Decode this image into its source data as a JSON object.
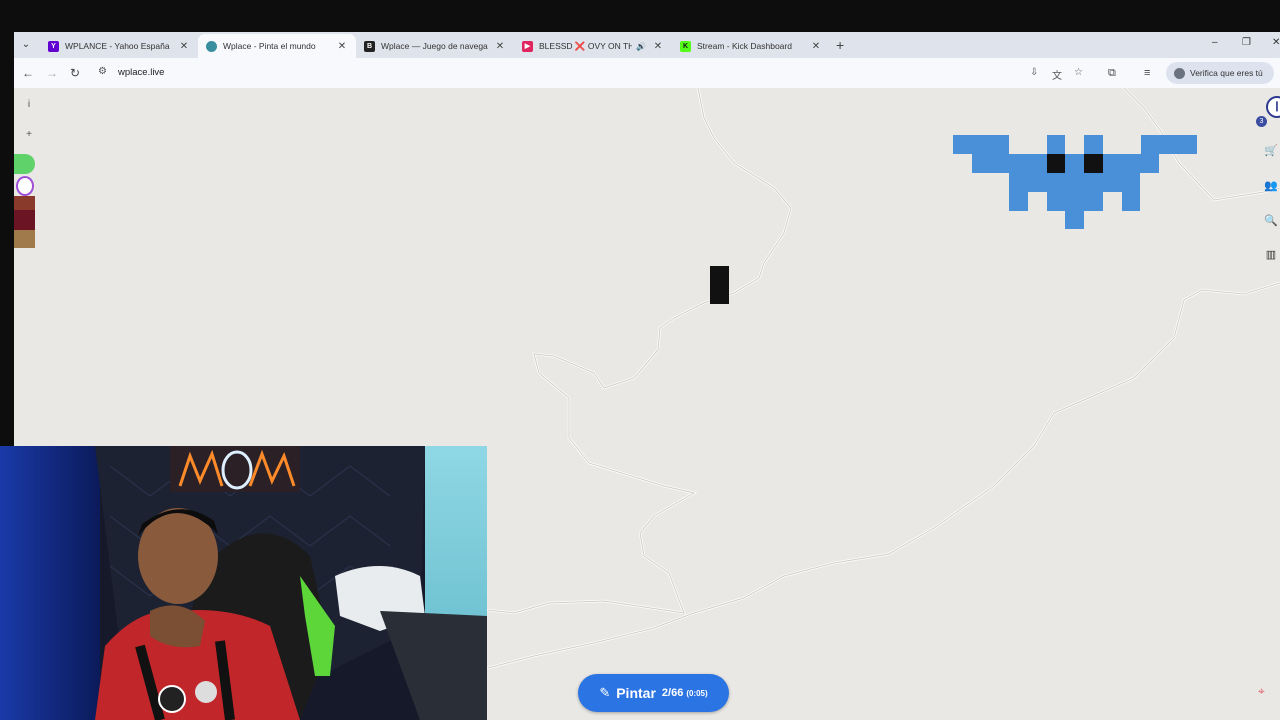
{
  "browser": {
    "tabs": [
      {
        "title": "WPLANCE - Yahoo España Res...",
        "favicon": "yahoo-icon",
        "color": "#6001d2",
        "glyph": "Y",
        "active": false
      },
      {
        "title": "Wplace - Pinta el mundo",
        "favicon": "globe-icon",
        "color": "#3a8f9f",
        "glyph": "",
        "active": true
      },
      {
        "title": "Wplace — Juego de navegador...",
        "favicon": "b-icon",
        "color": "#222222",
        "glyph": "B",
        "active": false
      },
      {
        "title": "BLESSD ❌ OVY ON THE DRUMS",
        "favicon": "youtube-icon",
        "color": "#e0245e",
        "glyph": "▶",
        "active": false,
        "audio": "🔊"
      },
      {
        "title": "Stream - Kick Dashboard",
        "favicon": "kick-icon",
        "color": "#53fc18",
        "glyph": "K",
        "active": false
      }
    ],
    "close_glyph": "✕",
    "new_tab_glyph": "+",
    "window_controls": {
      "minimize": "–",
      "restore": "❐",
      "close": "✕"
    },
    "nav": {
      "back": "←",
      "forward": "→",
      "reload": "↻"
    },
    "url": "wplace.live",
    "verify_label": "Verifica que eres tú",
    "menu_glyph": "⋮"
  },
  "map": {
    "left_controls": {
      "info": "i",
      "zoom_in": "+",
      "zoom_out": "-"
    },
    "palette": [
      "#5fd36a",
      "#a04fd9",
      "#7a1f2c",
      "#6b1424",
      "#a07a4a"
    ],
    "right_badge": "3",
    "pintar": {
      "label": "Pintar",
      "count": "2/66",
      "timer": "(0:05)"
    },
    "bat_color": "#4a90d9",
    "pixel_color": "#111111"
  }
}
